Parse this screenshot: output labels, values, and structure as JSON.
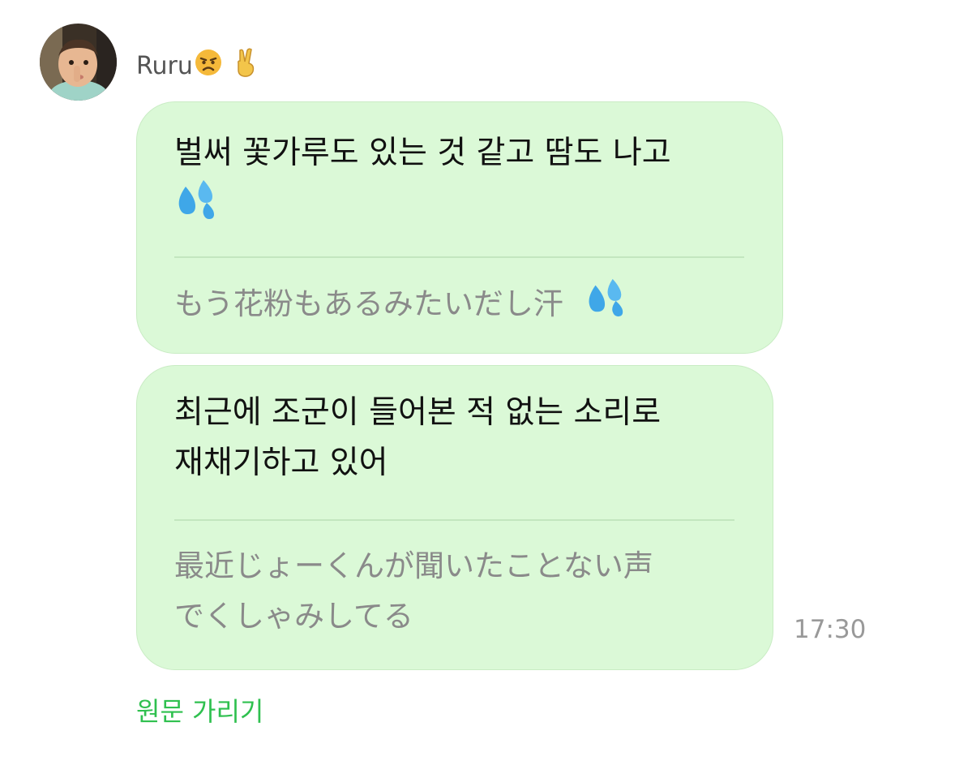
{
  "sender": {
    "name": "Ruru",
    "icons": [
      "angry-face-emoji",
      "victory-hand-emoji"
    ]
  },
  "messages": [
    {
      "text": "벌써 꽃가루도 있는 것 같고 땀도 나고",
      "text_icon": "sweat-droplets-emoji",
      "translation": "もう花粉もあるみたいだし汗",
      "translation_icon": "sweat-droplets-emoji"
    },
    {
      "text_line1": "최근에 조군이 들어본 적 없는 소리로",
      "text_line2": "재채기하고 있어",
      "translation_line1": "最近じょーくんが聞いたことない声",
      "translation_line2": "でくしゃみしてる"
    }
  ],
  "timestamp": "17:30",
  "hide_original_label": "원문 가리기",
  "colors": {
    "bubble_bg": "#dbf9d7",
    "bubble_border": "#c9ecc4",
    "link_green": "#2fc04f",
    "translation_text": "#8a8a8a"
  }
}
